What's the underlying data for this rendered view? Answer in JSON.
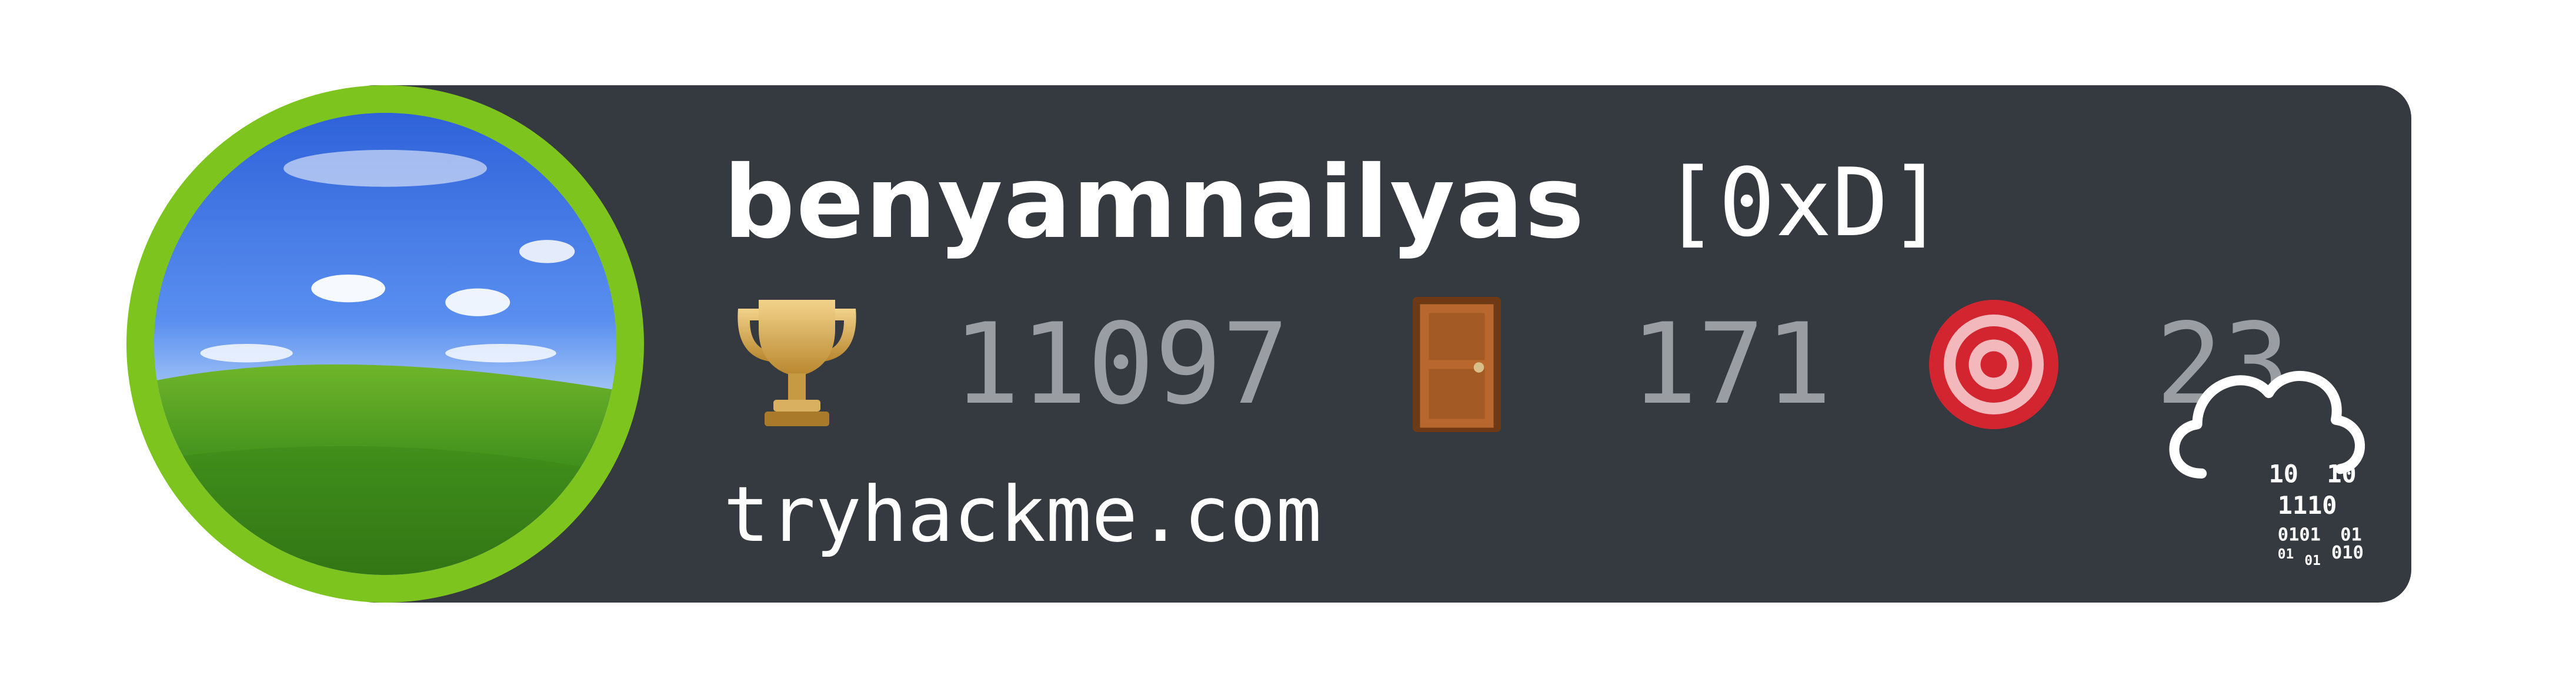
{
  "profile": {
    "username": "benyamnailyas",
    "rank": "[0xD]",
    "site": "tryhackme.com"
  },
  "stats": {
    "points": "11097",
    "rooms": "171",
    "badges": "23"
  },
  "icons": {
    "points": "trophy-icon",
    "rooms": "door-icon",
    "badges": "target-icon",
    "logo": "cloud-binary-logo-icon"
  },
  "logo_binary": [
    "10",
    "10",
    "1110",
    "0101",
    "01",
    "01",
    "01",
    "010"
  ],
  "colors": {
    "card_background": "#343a40",
    "avatar_ring": "#7ec41e",
    "username": "#ffffff",
    "stat_values": "#9a9ea3"
  }
}
